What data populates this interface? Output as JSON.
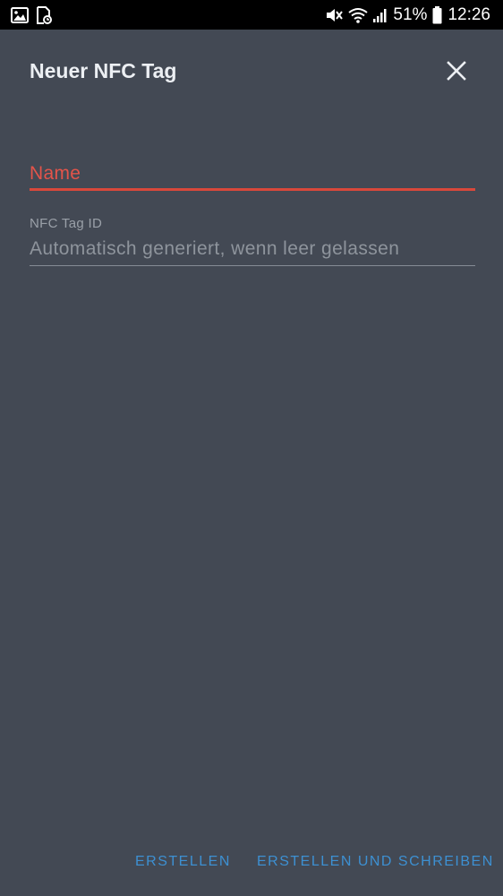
{
  "status_bar": {
    "icons_left": [
      "gallery-icon",
      "screenshot-icon"
    ],
    "icons_right": [
      "mute-icon",
      "wifi-icon",
      "signal-icon",
      "battery-icon"
    ],
    "battery": "51%",
    "time": "12:26"
  },
  "dialog": {
    "title": "Neuer NFC Tag",
    "close_icon": "close-icon",
    "name_field": {
      "placeholder": "Name",
      "value": ""
    },
    "nfc_field": {
      "label": "NFC Tag ID",
      "placeholder": "Automatisch generiert, wenn leer gelassen",
      "value": ""
    },
    "actions": {
      "create": "ERSTELLEN",
      "create_and_write": "ERSTELLEN UND SCHREIBEN"
    }
  },
  "colors": {
    "background": "#434954",
    "error": "#e4544a",
    "accent": "#3d90d2"
  }
}
